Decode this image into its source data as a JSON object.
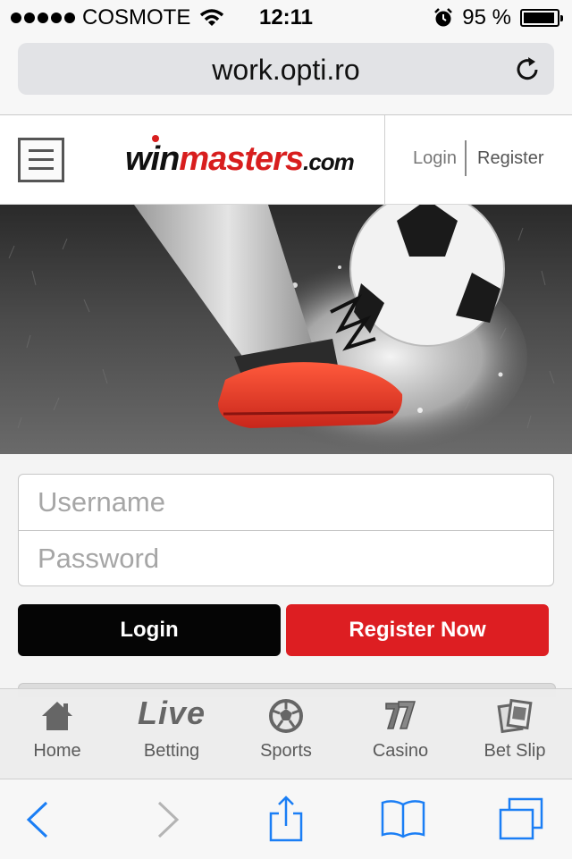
{
  "status_bar": {
    "carrier": "COSMOTE",
    "time": "12:11",
    "battery_text": "95 %",
    "battery_level": 0.95
  },
  "browser": {
    "url": "work.opti.ro"
  },
  "site_header": {
    "logo": {
      "part1": "win",
      "part2": "masters",
      "part3": ".com"
    },
    "login_link": "Login",
    "register_link": "Register"
  },
  "login_form": {
    "username_placeholder": "Username",
    "password_placeholder": "Password",
    "login_button": "Login",
    "register_button": "Register Now"
  },
  "app_nav": {
    "items": [
      {
        "label": "Home",
        "icon": "home-icon"
      },
      {
        "label": "Betting",
        "icon_text": "Live",
        "icon": "live-icon"
      },
      {
        "label": "Sports",
        "icon": "soccer-ball-icon"
      },
      {
        "label": "Casino",
        "icon": "casino-sevens-icon"
      },
      {
        "label": "Bet Slip",
        "icon": "bet-slip-icon"
      }
    ]
  },
  "colors": {
    "brand_red": "#dd1e22",
    "ios_blue": "#1a7ef5",
    "login_black": "#050505"
  }
}
